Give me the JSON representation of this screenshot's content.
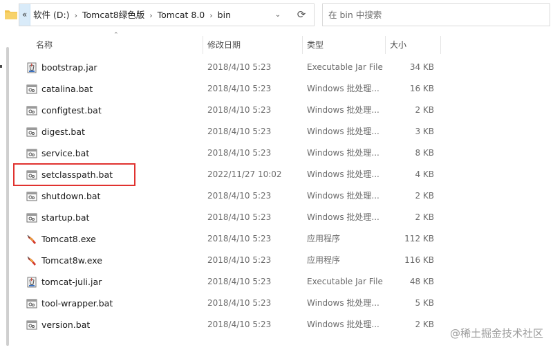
{
  "address_bar": {
    "back_history_glyph": "«",
    "crumbs": [
      "软件 (D:)",
      "Tomcat8绿色版",
      "Tomcat 8.0",
      "bin"
    ],
    "separator": "›",
    "dropdown_glyph": "⌄",
    "refresh_glyph": "⟳"
  },
  "search": {
    "placeholder": "在 bin 中搜索"
  },
  "columns": {
    "name": "名称",
    "modified": "修改日期",
    "type": "类型",
    "size": "大小"
  },
  "files": [
    {
      "name": "bootstrap.jar",
      "modified": "2018/4/10 5:23",
      "type": "Executable Jar File",
      "size": "34 KB",
      "icon": "jar-icon"
    },
    {
      "name": "catalina.bat",
      "modified": "2018/4/10 5:23",
      "type": "Windows 批处理...",
      "size": "16 KB",
      "icon": "bat-icon"
    },
    {
      "name": "configtest.bat",
      "modified": "2018/4/10 5:23",
      "type": "Windows 批处理...",
      "size": "2 KB",
      "icon": "bat-icon"
    },
    {
      "name": "digest.bat",
      "modified": "2018/4/10 5:23",
      "type": "Windows 批处理...",
      "size": "3 KB",
      "icon": "bat-icon"
    },
    {
      "name": "service.bat",
      "modified": "2018/4/10 5:23",
      "type": "Windows 批处理...",
      "size": "8 KB",
      "icon": "bat-icon"
    },
    {
      "name": "setclasspath.bat",
      "modified": "2022/11/27 10:02",
      "type": "Windows 批处理...",
      "size": "4 KB",
      "icon": "bat-icon",
      "highlighted": true
    },
    {
      "name": "shutdown.bat",
      "modified": "2018/4/10 5:23",
      "type": "Windows 批处理...",
      "size": "2 KB",
      "icon": "bat-icon"
    },
    {
      "name": "startup.bat",
      "modified": "2018/4/10 5:23",
      "type": "Windows 批处理...",
      "size": "2 KB",
      "icon": "bat-icon"
    },
    {
      "name": "Tomcat8.exe",
      "modified": "2018/4/10 5:23",
      "type": "应用程序",
      "size": "112 KB",
      "icon": "tomcat-icon"
    },
    {
      "name": "Tomcat8w.exe",
      "modified": "2018/4/10 5:23",
      "type": "应用程序",
      "size": "116 KB",
      "icon": "tomcat-icon"
    },
    {
      "name": "tomcat-juli.jar",
      "modified": "2018/4/10 5:23",
      "type": "Executable Jar File",
      "size": "48 KB",
      "icon": "jar-icon"
    },
    {
      "name": "tool-wrapper.bat",
      "modified": "2018/4/10 5:23",
      "type": "Windows 批处理...",
      "size": "5 KB",
      "icon": "bat-icon"
    },
    {
      "name": "version.bat",
      "modified": "2018/4/10 5:23",
      "type": "Windows 批处理...",
      "size": "2 KB",
      "icon": "bat-icon"
    }
  ],
  "watermark": "@稀土掘金技术社区",
  "colors": {
    "highlight": "#e0322f",
    "folder": "#f3c34b",
    "tomcat": "#d33a2c"
  }
}
